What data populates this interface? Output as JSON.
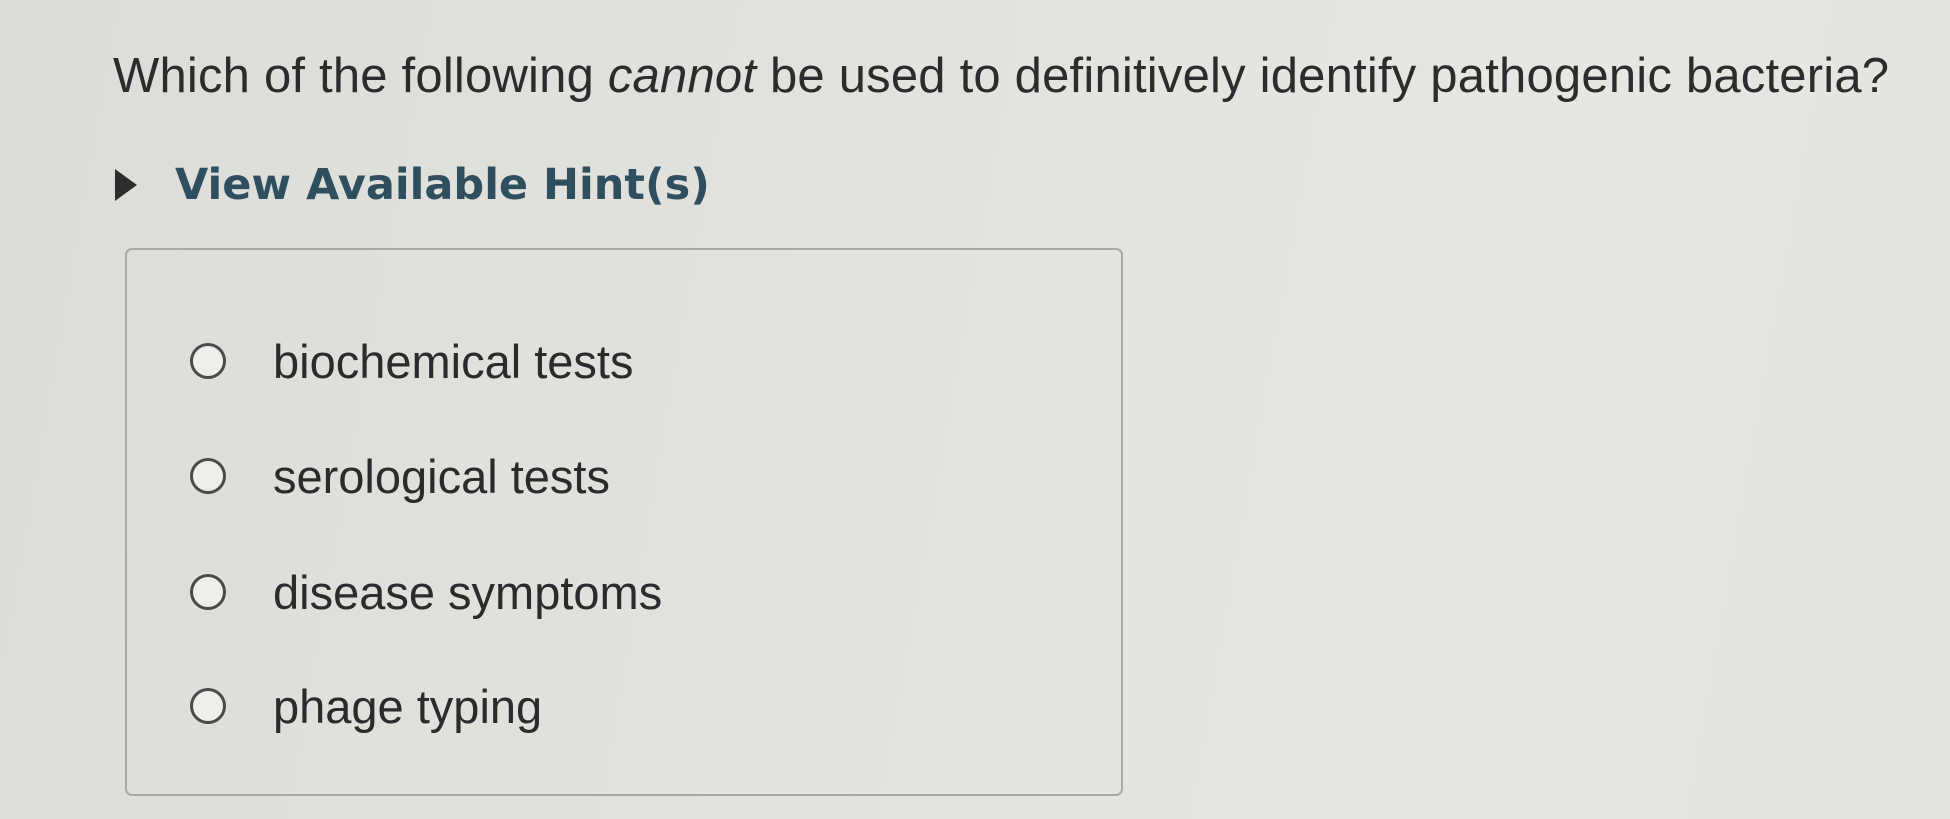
{
  "question": {
    "before": "Which of the following ",
    "emphasis": "cannot",
    "after": " be used to definitively identify pathogenic bacteria?"
  },
  "hint": {
    "label": "View Available Hint(s)",
    "icon": "triangle-right-icon"
  },
  "options": [
    {
      "label": "biochemical tests",
      "selected": false
    },
    {
      "label": "serological tests",
      "selected": false
    },
    {
      "label": "disease symptoms",
      "selected": false
    },
    {
      "label": "phage typing",
      "selected": false
    }
  ]
}
